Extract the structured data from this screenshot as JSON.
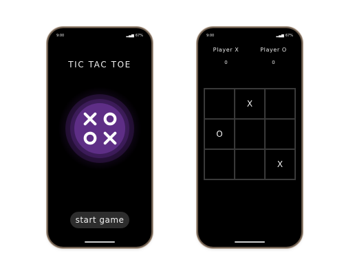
{
  "status": {
    "time": "9:00",
    "battery": "67%"
  },
  "home_screen": {
    "title": "TIC TAC TOE",
    "logo": {
      "cells": [
        "X",
        "O",
        "O",
        "X"
      ],
      "circle_color": "#5e2e86",
      "mark_color": "#ffffff"
    },
    "start_button_label": "start game"
  },
  "game_screen": {
    "players": [
      {
        "name": "Player X",
        "score": "0"
      },
      {
        "name": "Player O",
        "score": "0"
      }
    ],
    "board": [
      "",
      "X",
      "",
      "O",
      "",
      "",
      "",
      "",
      "X"
    ]
  },
  "colors": {
    "background": "#000000",
    "accent": "#5e2e86",
    "grid_line": "#3a3a3a"
  }
}
